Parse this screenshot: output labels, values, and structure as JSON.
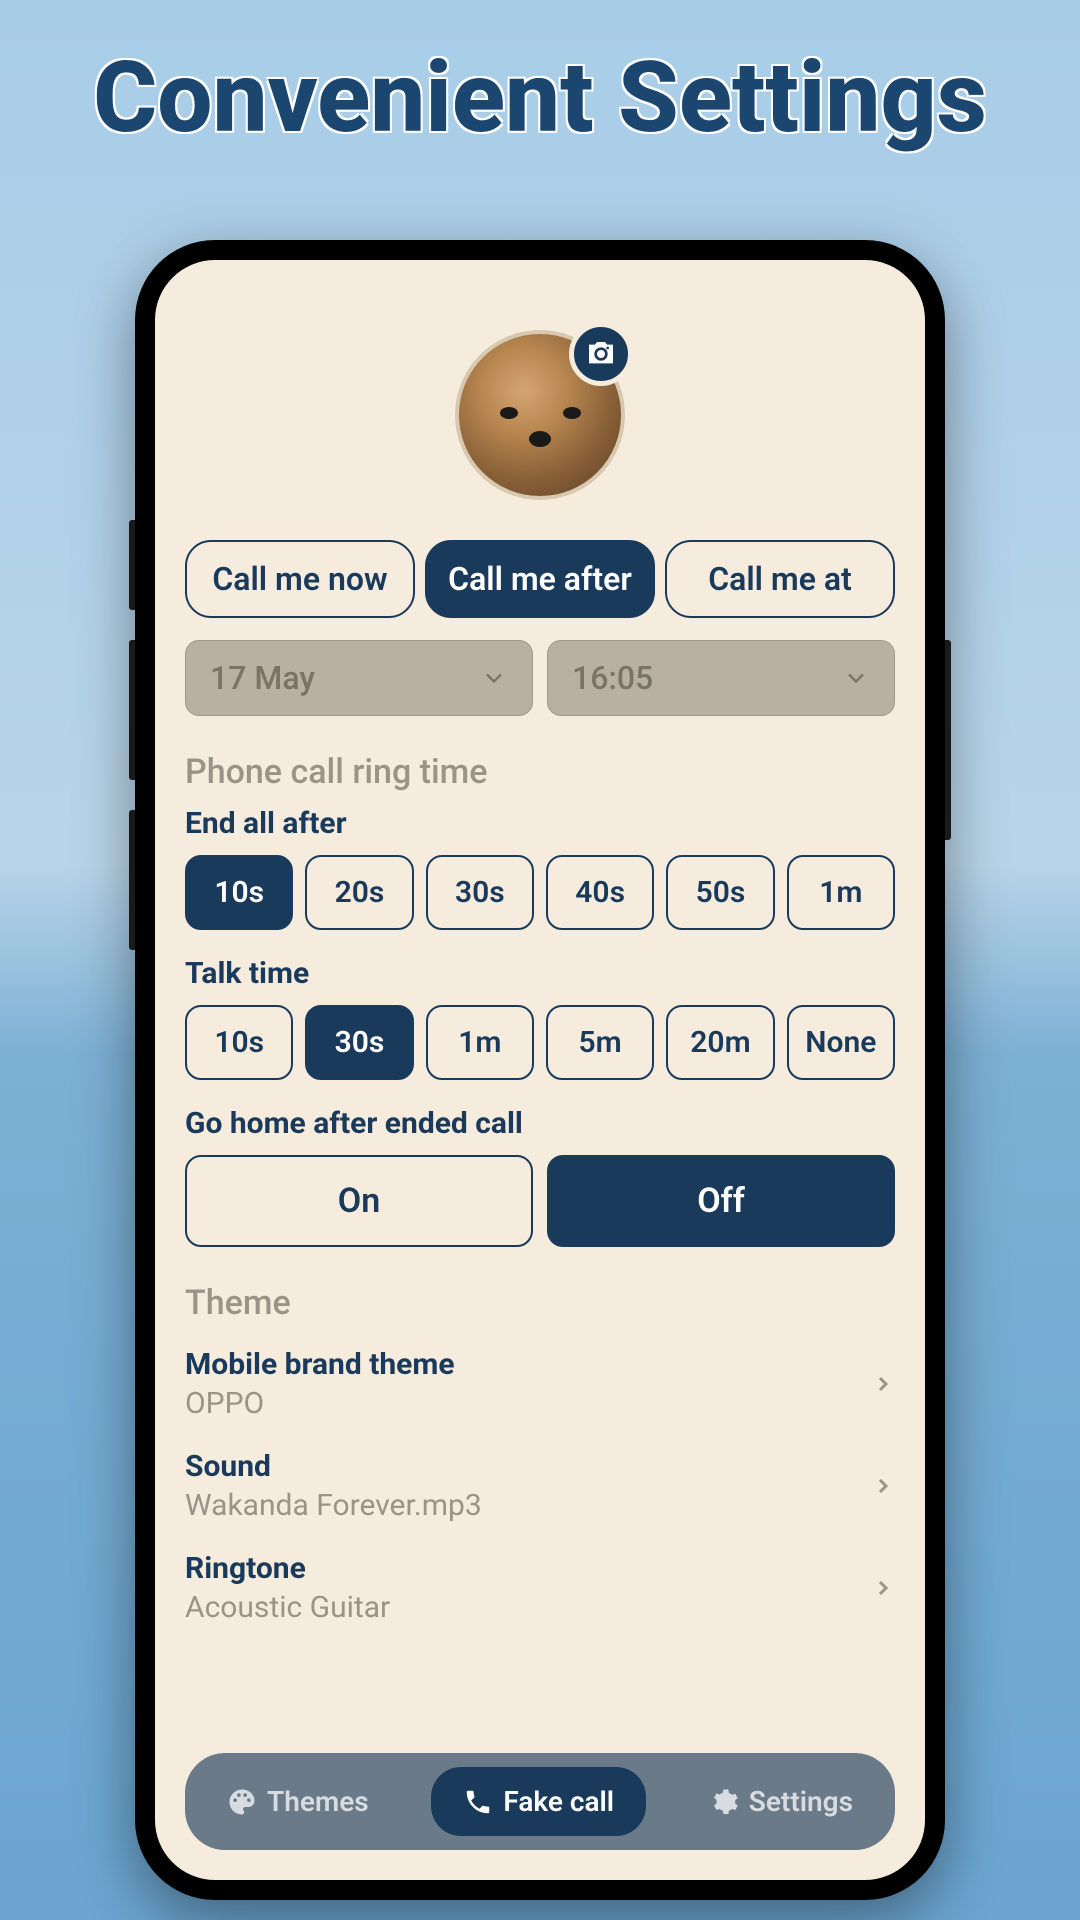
{
  "headline": "Convenient Settings",
  "tabs": {
    "now": "Call me now",
    "after": "Call me after",
    "at": "Call me at"
  },
  "dropdowns": {
    "date": "17 May",
    "time": "16:05"
  },
  "ringTime": {
    "section": "Phone call ring time",
    "endAll": {
      "label": "End all after",
      "options": [
        "10s",
        "20s",
        "30s",
        "40s",
        "50s",
        "1m"
      ],
      "selected": "10s"
    },
    "talk": {
      "label": "Talk time",
      "options": [
        "10s",
        "30s",
        "1m",
        "5m",
        "20m",
        "None"
      ],
      "selected": "30s"
    },
    "goHome": {
      "label": "Go home after ended call",
      "on": "On",
      "off": "Off",
      "selected": "Off"
    }
  },
  "theme": {
    "section": "Theme",
    "brand": {
      "label": "Mobile brand theme",
      "value": "OPPO"
    },
    "sound": {
      "label": "Sound",
      "value": "Wakanda Forever.mp3"
    },
    "ringtone": {
      "label": "Ringtone",
      "value": "Acoustic Guitar"
    }
  },
  "nav": {
    "themes": "Themes",
    "fakecall": "Fake call",
    "settings": "Settings"
  }
}
